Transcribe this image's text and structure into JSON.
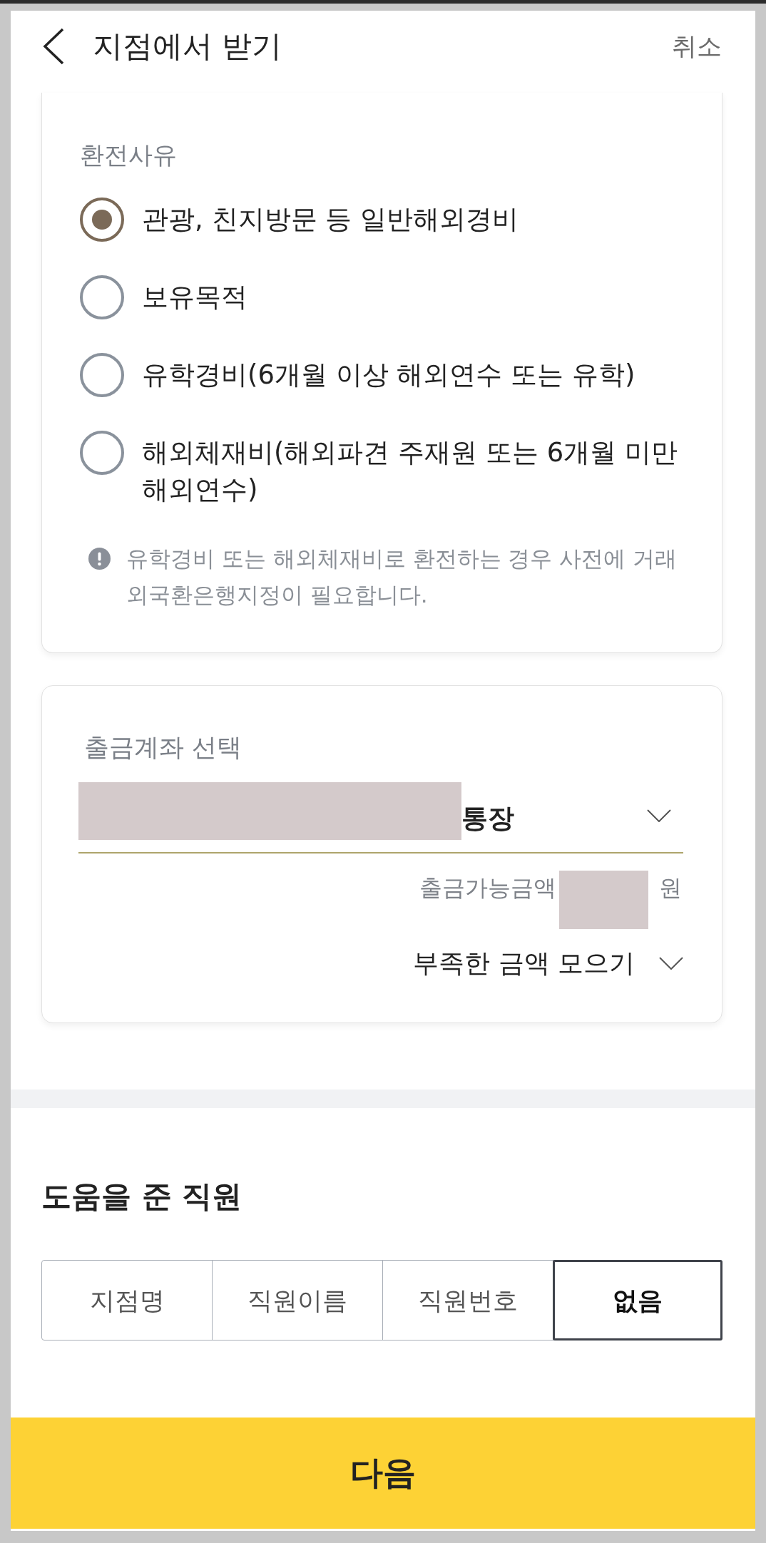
{
  "header": {
    "title": "지점에서 받기",
    "cancel": "취소"
  },
  "exchange_reason": {
    "label": "환전사유",
    "options": [
      {
        "label": "관광, 친지방문 등 일반해외경비",
        "selected": true
      },
      {
        "label": "보유목적",
        "selected": false
      },
      {
        "label": "유학경비(6개월 이상 해외연수 또는 유학)",
        "selected": false
      },
      {
        "label": "해외체재비(해외파견 주재원 또는 6개월 미만 해외연수)",
        "selected": false
      }
    ],
    "notice": "유학경비 또는 해외체재비로 환전하는 경우 사전에 거래 외국환은행지정이 필요합니다."
  },
  "withdrawal_account": {
    "label": "출금계좌 선택",
    "account": {
      "name": "통장",
      "redacted": true
    },
    "balance": {
      "label": "출금가능금액",
      "redacted": true,
      "unit": "원"
    },
    "collect_shortfall": "부족한 금액 모으기"
  },
  "helper_staff": {
    "title": "도움을 준 직원",
    "options": [
      {
        "label": "지점명",
        "selected": false
      },
      {
        "label": "직원이름",
        "selected": false
      },
      {
        "label": "직원번호",
        "selected": false
      },
      {
        "label": "없음",
        "selected": true
      }
    ]
  },
  "next_button": "다음"
}
